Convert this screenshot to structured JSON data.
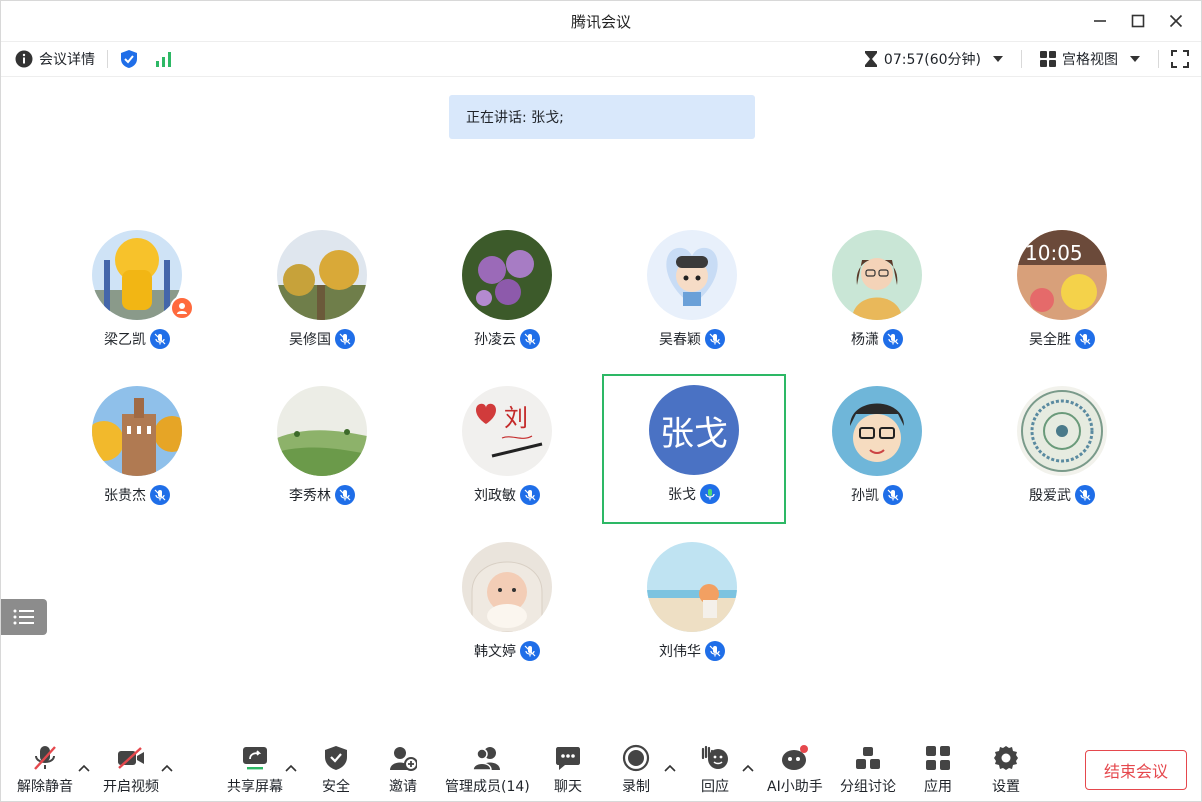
{
  "window": {
    "title": "腾讯会议"
  },
  "infobar": {
    "meeting_details": "会议详情",
    "timer": "07:57(60分钟)",
    "view_mode": "宫格视图"
  },
  "speaking": {
    "text": "正在讲话: 张戈;"
  },
  "participants": [
    {
      "name": "梁乙凯",
      "is_host": true
    },
    {
      "name": "吴修国"
    },
    {
      "name": "孙凌云"
    },
    {
      "name": "吴春颖"
    },
    {
      "name": "杨潇"
    },
    {
      "name": "吴全胜",
      "avatar_text": "10:05"
    },
    {
      "name": "张贵杰"
    },
    {
      "name": "李秀林"
    },
    {
      "name": "刘政敏",
      "avatar_text": "刘"
    },
    {
      "name": "张戈",
      "avatar_text": "张戈",
      "speaking": true
    },
    {
      "name": "孙凯"
    },
    {
      "name": "殷爱武"
    },
    {
      "name": "韩文婷"
    },
    {
      "name": "刘伟华"
    }
  ],
  "toolbar": {
    "unmute": "解除静音",
    "start_video": "开启视频",
    "share_screen": "共享屏幕",
    "security": "安全",
    "invite": "邀请",
    "manage_members": "管理成员(14)",
    "chat": "聊天",
    "record": "录制",
    "react": "回应",
    "ai_assistant": "AI小助手",
    "breakout": "分组讨论",
    "apps": "应用",
    "settings": "设置",
    "end_meeting": "结束会议"
  },
  "colors": {
    "accent_blue": "#1f6ee8",
    "speaking_bg": "#d9e8fb",
    "active_border": "#2db865",
    "end_red": "#e5484d",
    "signal_green": "#2db865"
  }
}
